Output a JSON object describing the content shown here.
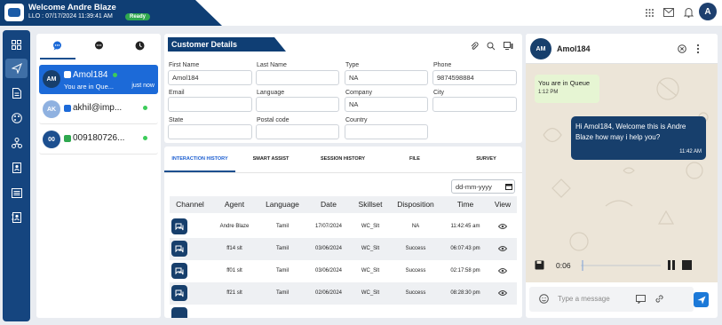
{
  "header": {
    "welcome": "Welcome Andre Blaze",
    "login_info": "LLO : 07/17/2024   11:39:41 AM",
    "status": "Ready",
    "avatar_initial": "A",
    "colors": {
      "brand": "#0f3e74",
      "ready": "#2fa84f"
    }
  },
  "rail": {
    "items": [
      "dashboard-icon",
      "send-icon",
      "document-icon",
      "palette-icon",
      "workflow-icon",
      "contact-card-icon",
      "list-icon",
      "contact-book-icon"
    ]
  },
  "chatlist": {
    "tabs": [
      "chat-icon",
      "chat-alt-icon",
      "history-icon"
    ],
    "items": [
      {
        "initials": "AM",
        "name": "Amol184",
        "preview": "You are in Que...",
        "time": "just now"
      },
      {
        "initials": "AK",
        "name": "akhil@imp...",
        "preview": "",
        "time": ""
      },
      {
        "initials": "00",
        "name": "009180726...",
        "preview": "",
        "time": ""
      }
    ]
  },
  "customer": {
    "title": "Customer Details",
    "fields": {
      "first_name_label": "First Name",
      "first_name": "Amol184",
      "last_name_label": "Last Name",
      "last_name": "",
      "type_label": "Type",
      "type": "NA",
      "phone_label": "Phone",
      "phone": "9874598884",
      "email_label": "Email",
      "email": "",
      "language_label": "Language",
      "language": "",
      "company_label": "Company",
      "company": "NA",
      "city_label": "City",
      "city": "",
      "state_label": "State",
      "state": "",
      "postal_label": "Postal code",
      "postal": "",
      "country_label": "Country",
      "country": ""
    }
  },
  "history": {
    "tabs": [
      "INTERACTION HISTORY",
      "SMART ASSIST",
      "SESSION HISTORY",
      "FILE",
      "SURVEY"
    ],
    "date_placeholder": "dd-mm-yyyy",
    "columns": [
      "Channel",
      "Agent",
      "Language",
      "Date",
      "Skillset",
      "Disposition",
      "Time",
      "View"
    ],
    "rows": [
      {
        "agent": "Andre Blaze",
        "language": "Tamil",
        "date": "17/07/2024",
        "skillset": "WC_Slt",
        "disposition": "NA",
        "time": "11:42:45 am"
      },
      {
        "agent": "ff14 slt",
        "language": "Tamil",
        "date": "03/06/2024",
        "skillset": "WC_Slt",
        "disposition": "Success",
        "time": "06:07:43 pm"
      },
      {
        "agent": "ff01 slt",
        "language": "Tamil",
        "date": "03/06/2024",
        "skillset": "WC_Slt",
        "disposition": "Success",
        "time": "02:17:58 pm"
      },
      {
        "agent": "ff21 slt",
        "language": "Tamil",
        "date": "02/06/2024",
        "skillset": "WC_Slt",
        "disposition": "Success",
        "time": "08:28:30 pm"
      }
    ]
  },
  "conversation": {
    "initials": "AM",
    "name": "Amol184",
    "messages": [
      {
        "dir": "in",
        "text": "You are in Queue",
        "time": "1:12 PM"
      },
      {
        "dir": "out",
        "text": "Hi Amol184, Welcome this is  Andre Blaze how may i help you?",
        "time": "11:42 AM"
      }
    ],
    "audio_time": "0:06",
    "compose_placeholder": "Type a message"
  }
}
